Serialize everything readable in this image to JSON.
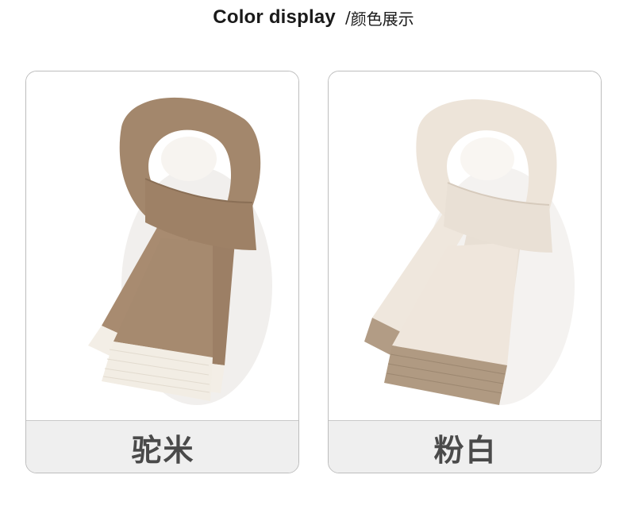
{
  "header": {
    "title_en": "Color display",
    "separator": "/",
    "title_cn": "颜色展示"
  },
  "products": [
    {
      "color_name": "驼米",
      "image": "camel-scarf-with-cream-trim",
      "main_color": "#a6896f",
      "trim_color": "#f2ede4"
    },
    {
      "color_name": "粉白",
      "image": "cream-scarf-with-camel-trim",
      "main_color": "#eee4d9",
      "trim_color": "#b09a82"
    }
  ]
}
